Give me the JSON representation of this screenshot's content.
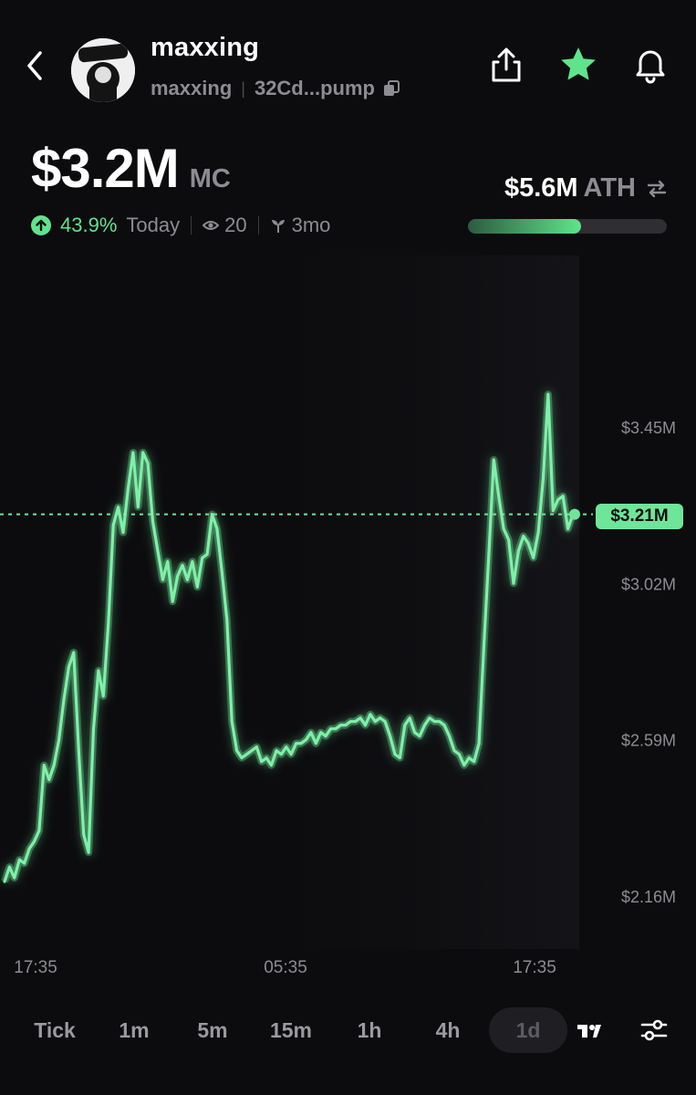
{
  "header": {
    "token_name": "maxxing",
    "ticker": "maxxing",
    "address": "32Cd...pump",
    "avatar_text": "maxxing",
    "icons": [
      "back-chevron-icon",
      "share-icon",
      "star-icon",
      "bell-icon"
    ],
    "favorited": true
  },
  "summary": {
    "market_cap": "$3.2M",
    "market_cap_unit": "MC",
    "change_pct": "43.9%",
    "change_period": "Today",
    "watchers": "20",
    "age": "3mo",
    "ath_value": "$5.6M",
    "ath_label": "ATH",
    "ath_progress": 0.57
  },
  "colors": {
    "accent": "#5fe48c",
    "line": "#6fe59a",
    "background": "#0c0c0e",
    "muted": "#8c8c92"
  },
  "chart_data": {
    "type": "line",
    "y_tick_labels": [
      "$3.45M",
      "$3.02M",
      "$2.59M",
      "$2.16M"
    ],
    "y_ticks": [
      3.45,
      3.02,
      2.59,
      2.16
    ],
    "y_unit": "$M",
    "x_tick_labels": [
      "17:35",
      "05:35",
      "17:35"
    ],
    "current_price_label": "$3.21M",
    "current_price": 3.21,
    "series": [
      {
        "values": [
          2.2,
          2.24,
          2.21,
          2.26,
          2.25,
          2.29,
          2.31,
          2.34,
          2.52,
          2.48,
          2.52,
          2.59,
          2.7,
          2.79,
          2.83,
          2.56,
          2.33,
          2.28,
          2.62,
          2.78,
          2.71,
          2.91,
          3.18,
          3.23,
          3.16,
          3.28,
          3.38,
          3.23,
          3.38,
          3.35,
          3.19,
          3.11,
          3.03,
          3.08,
          2.97,
          3.04,
          3.07,
          3.03,
          3.08,
          3.01,
          3.09,
          3.1,
          3.21,
          3.17,
          3.05,
          2.92,
          2.64,
          2.56,
          2.54,
          2.55,
          2.56,
          2.57,
          2.53,
          2.54,
          2.52,
          2.56,
          2.55,
          2.57,
          2.55,
          2.58,
          2.58,
          2.59,
          2.61,
          2.58,
          2.61,
          2.6,
          2.62,
          2.62,
          2.63,
          2.63,
          2.64,
          2.64,
          2.65,
          2.63,
          2.66,
          2.64,
          2.65,
          2.64,
          2.6,
          2.55,
          2.54,
          2.63,
          2.65,
          2.61,
          2.6,
          2.63,
          2.65,
          2.64,
          2.64,
          2.63,
          2.6,
          2.56,
          2.55,
          2.52,
          2.54,
          2.53,
          2.58,
          2.85,
          3.1,
          3.36,
          3.26,
          3.17,
          3.14,
          3.02,
          3.11,
          3.15,
          3.13,
          3.09,
          3.16,
          3.31,
          3.54,
          3.22,
          3.25,
          3.26,
          3.17,
          3.21
        ]
      }
    ],
    "grid": false,
    "legend": "none"
  },
  "timeframes": {
    "items": [
      "Tick",
      "1m",
      "5m",
      "15m",
      "1h",
      "4h",
      "1d"
    ],
    "active": "1d",
    "tools": [
      "tradingview-icon",
      "chart-settings-icon"
    ]
  }
}
